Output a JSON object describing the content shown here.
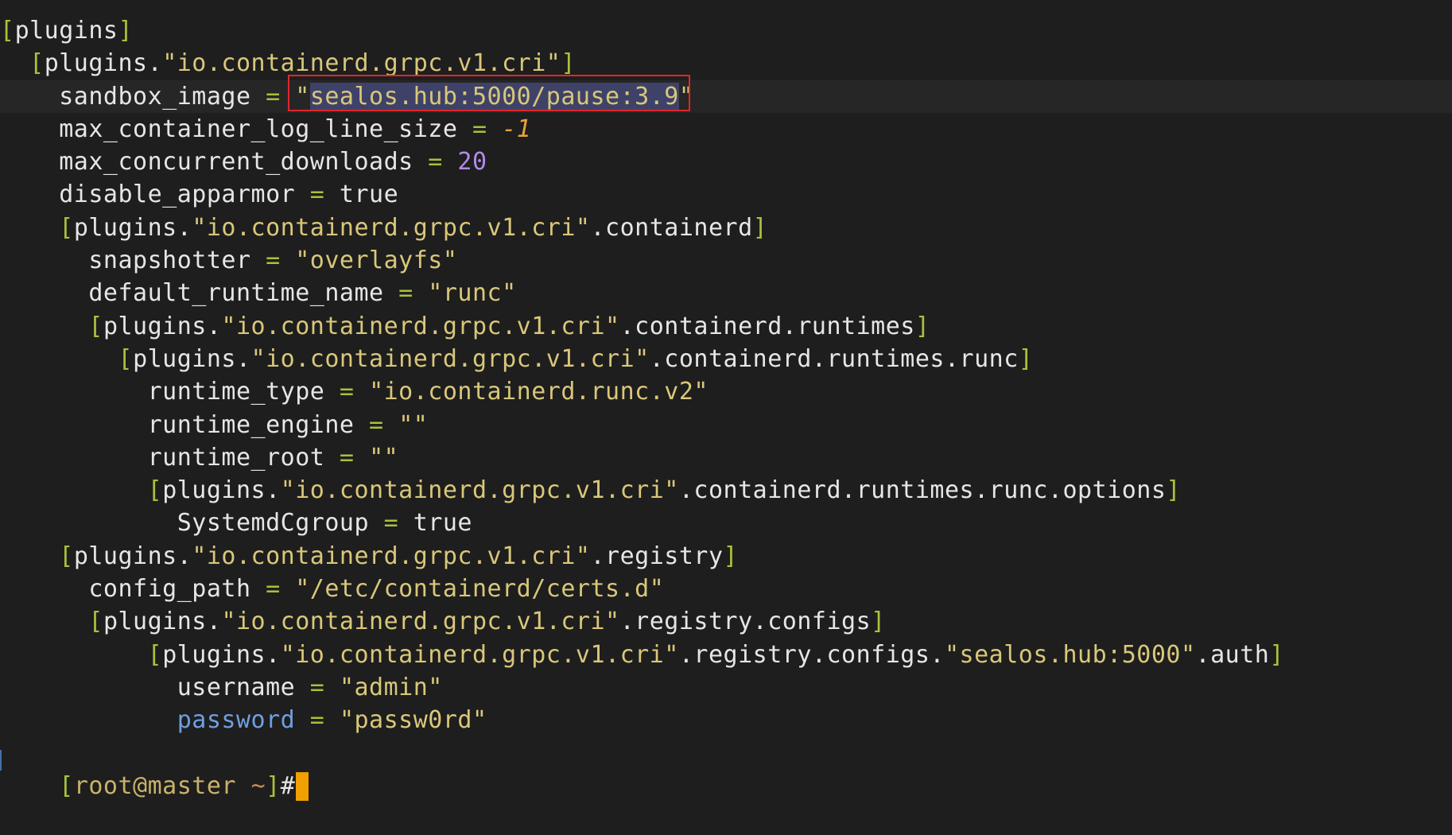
{
  "terminal": {
    "lines": [
      {
        "indent": "",
        "current": false,
        "tokens": [
          {
            "t": "[",
            "c": "bracket"
          },
          {
            "t": "plugins",
            "c": "key"
          },
          {
            "t": "]",
            "c": "bracket"
          }
        ]
      },
      {
        "indent": "  ",
        "current": false,
        "tokens": [
          {
            "t": "[",
            "c": "bracket"
          },
          {
            "t": "plugins.",
            "c": "key"
          },
          {
            "t": "\"io.containerd.grpc.v1.cri\"",
            "c": "str"
          },
          {
            "t": "]",
            "c": "bracket"
          }
        ]
      },
      {
        "indent": "    ",
        "current": true,
        "tokens": [
          {
            "t": "sandbox_image",
            "c": "key"
          },
          {
            "t": " = ",
            "c": "op"
          },
          {
            "t": "\"",
            "c": "str"
          },
          {
            "t": "sealos.hub:5000/pause:3.9",
            "c": "sel"
          },
          {
            "t": "\"",
            "c": "str"
          }
        ]
      },
      {
        "indent": "    ",
        "current": false,
        "tokens": [
          {
            "t": "max_container_log_line_size",
            "c": "key"
          },
          {
            "t": " = ",
            "c": "op"
          },
          {
            "t": "-1",
            "c": "numneg"
          }
        ]
      },
      {
        "indent": "    ",
        "current": false,
        "tokens": [
          {
            "t": "max_concurrent_downloads",
            "c": "key"
          },
          {
            "t": " = ",
            "c": "op"
          },
          {
            "t": "20",
            "c": "num"
          }
        ]
      },
      {
        "indent": "    ",
        "current": false,
        "tokens": [
          {
            "t": "disable_apparmor",
            "c": "key"
          },
          {
            "t": " = ",
            "c": "op"
          },
          {
            "t": "true",
            "c": "plain"
          }
        ]
      },
      {
        "indent": "    ",
        "current": false,
        "tokens": [
          {
            "t": "[",
            "c": "bracket"
          },
          {
            "t": "plugins.",
            "c": "key"
          },
          {
            "t": "\"io.containerd.grpc.v1.cri\"",
            "c": "str"
          },
          {
            "t": ".containerd",
            "c": "key"
          },
          {
            "t": "]",
            "c": "bracket"
          }
        ]
      },
      {
        "indent": "      ",
        "current": false,
        "tokens": [
          {
            "t": "snapshotter",
            "c": "key"
          },
          {
            "t": " = ",
            "c": "op"
          },
          {
            "t": "\"overlayfs\"",
            "c": "str"
          }
        ]
      },
      {
        "indent": "      ",
        "current": false,
        "tokens": [
          {
            "t": "default_runtime_name",
            "c": "key"
          },
          {
            "t": " = ",
            "c": "op"
          },
          {
            "t": "\"runc\"",
            "c": "str"
          }
        ]
      },
      {
        "indent": "      ",
        "current": false,
        "tokens": [
          {
            "t": "[",
            "c": "bracket"
          },
          {
            "t": "plugins.",
            "c": "key"
          },
          {
            "t": "\"io.containerd.grpc.v1.cri\"",
            "c": "str"
          },
          {
            "t": ".containerd.runtimes",
            "c": "key"
          },
          {
            "t": "]",
            "c": "bracket"
          }
        ]
      },
      {
        "indent": "        ",
        "current": false,
        "tokens": [
          {
            "t": "[",
            "c": "bracket"
          },
          {
            "t": "plugins.",
            "c": "key"
          },
          {
            "t": "\"io.containerd.grpc.v1.cri\"",
            "c": "str"
          },
          {
            "t": ".containerd.runtimes.runc",
            "c": "key"
          },
          {
            "t": "]",
            "c": "bracket"
          }
        ]
      },
      {
        "indent": "          ",
        "current": false,
        "tokens": [
          {
            "t": "runtime_type",
            "c": "key"
          },
          {
            "t": " = ",
            "c": "op"
          },
          {
            "t": "\"io.containerd.runc.v2\"",
            "c": "str"
          }
        ]
      },
      {
        "indent": "          ",
        "current": false,
        "tokens": [
          {
            "t": "runtime_engine",
            "c": "key"
          },
          {
            "t": " = ",
            "c": "op"
          },
          {
            "t": "\"\"",
            "c": "str"
          }
        ]
      },
      {
        "indent": "          ",
        "current": false,
        "tokens": [
          {
            "t": "runtime_root",
            "c": "key"
          },
          {
            "t": " = ",
            "c": "op"
          },
          {
            "t": "\"\"",
            "c": "str"
          }
        ]
      },
      {
        "indent": "          ",
        "current": false,
        "tokens": [
          {
            "t": "[",
            "c": "bracket"
          },
          {
            "t": "plugins.",
            "c": "key"
          },
          {
            "t": "\"io.containerd.grpc.v1.cri\"",
            "c": "str"
          },
          {
            "t": ".containerd.runtimes.runc.options",
            "c": "key"
          },
          {
            "t": "]",
            "c": "bracket"
          }
        ]
      },
      {
        "indent": "            ",
        "current": false,
        "tokens": [
          {
            "t": "SystemdCgroup",
            "c": "key"
          },
          {
            "t": " = ",
            "c": "op"
          },
          {
            "t": "true",
            "c": "plain"
          }
        ]
      },
      {
        "indent": "    ",
        "current": false,
        "tokens": [
          {
            "t": "[",
            "c": "bracket"
          },
          {
            "t": "plugins.",
            "c": "key"
          },
          {
            "t": "\"io.containerd.grpc.v1.cri\"",
            "c": "str"
          },
          {
            "t": ".registry",
            "c": "key"
          },
          {
            "t": "]",
            "c": "bracket"
          }
        ]
      },
      {
        "indent": "      ",
        "current": false,
        "tokens": [
          {
            "t": "config_path",
            "c": "key"
          },
          {
            "t": " = ",
            "c": "op"
          },
          {
            "t": "\"/etc/containerd/certs.d\"",
            "c": "str"
          }
        ]
      },
      {
        "indent": "      ",
        "current": false,
        "tokens": [
          {
            "t": "[",
            "c": "bracket"
          },
          {
            "t": "plugins.",
            "c": "key"
          },
          {
            "t": "\"io.containerd.grpc.v1.cri\"",
            "c": "str"
          },
          {
            "t": ".registry.configs",
            "c": "key"
          },
          {
            "t": "]",
            "c": "bracket"
          }
        ]
      },
      {
        "indent": "          ",
        "current": false,
        "tokens": [
          {
            "t": "[",
            "c": "bracket"
          },
          {
            "t": "plugins.",
            "c": "key"
          },
          {
            "t": "\"io.containerd.grpc.v1.cri\"",
            "c": "str"
          },
          {
            "t": ".registry.configs.",
            "c": "key"
          },
          {
            "t": "\"sealos.hub:5000\"",
            "c": "str"
          },
          {
            "t": ".auth",
            "c": "key"
          },
          {
            "t": "]",
            "c": "bracket"
          }
        ]
      },
      {
        "indent": "            ",
        "current": false,
        "tokens": [
          {
            "t": "username",
            "c": "key"
          },
          {
            "t": " = ",
            "c": "op"
          },
          {
            "t": "\"admin\"",
            "c": "str"
          }
        ]
      },
      {
        "indent": "            ",
        "current": false,
        "tokens": [
          {
            "t": "password",
            "c": "key-blue"
          },
          {
            "t": " = ",
            "c": "op"
          },
          {
            "t": "\"passw0rd\"",
            "c": "str"
          }
        ]
      }
    ],
    "prompt": {
      "open_bracket": "[",
      "user_host": "root@master",
      "space": " ",
      "path": "~",
      "close_bracket": "]",
      "symbol": "#"
    },
    "colors": {
      "background": "#1e1e1e",
      "highlight_box": "#e0262b",
      "cursor": "#f0a000"
    }
  }
}
